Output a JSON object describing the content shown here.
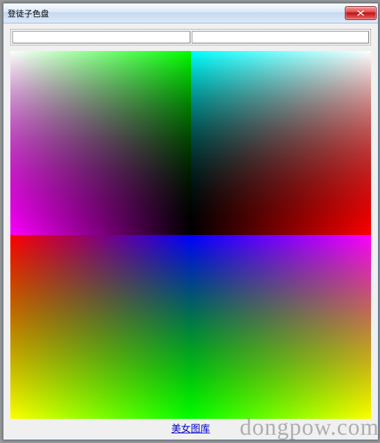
{
  "window": {
    "title": "登徒子色盘"
  },
  "inputs": {
    "left_value": "",
    "left_placeholder": "",
    "right_value": "",
    "right_placeholder": ""
  },
  "palette": {
    "quads": [
      {
        "tl": "#ffffff",
        "tr": "#00ff00",
        "bl": "#ff00ff",
        "br": "#000000"
      },
      {
        "tl": "#00ffff",
        "tr": "#ffffff",
        "bl": "#000000",
        "br": "#ff0000"
      },
      {
        "tl": "#ff0000",
        "tr": "#0000ff",
        "bl": "#ffff00",
        "br": "#00ff00"
      },
      {
        "tl": "#0000ff",
        "tr": "#ff00ff",
        "bl": "#00ff00",
        "br": "#ffff00"
      }
    ]
  },
  "footer": {
    "link_text": "美女图库"
  },
  "watermark": {
    "text": "dongpow.com"
  }
}
